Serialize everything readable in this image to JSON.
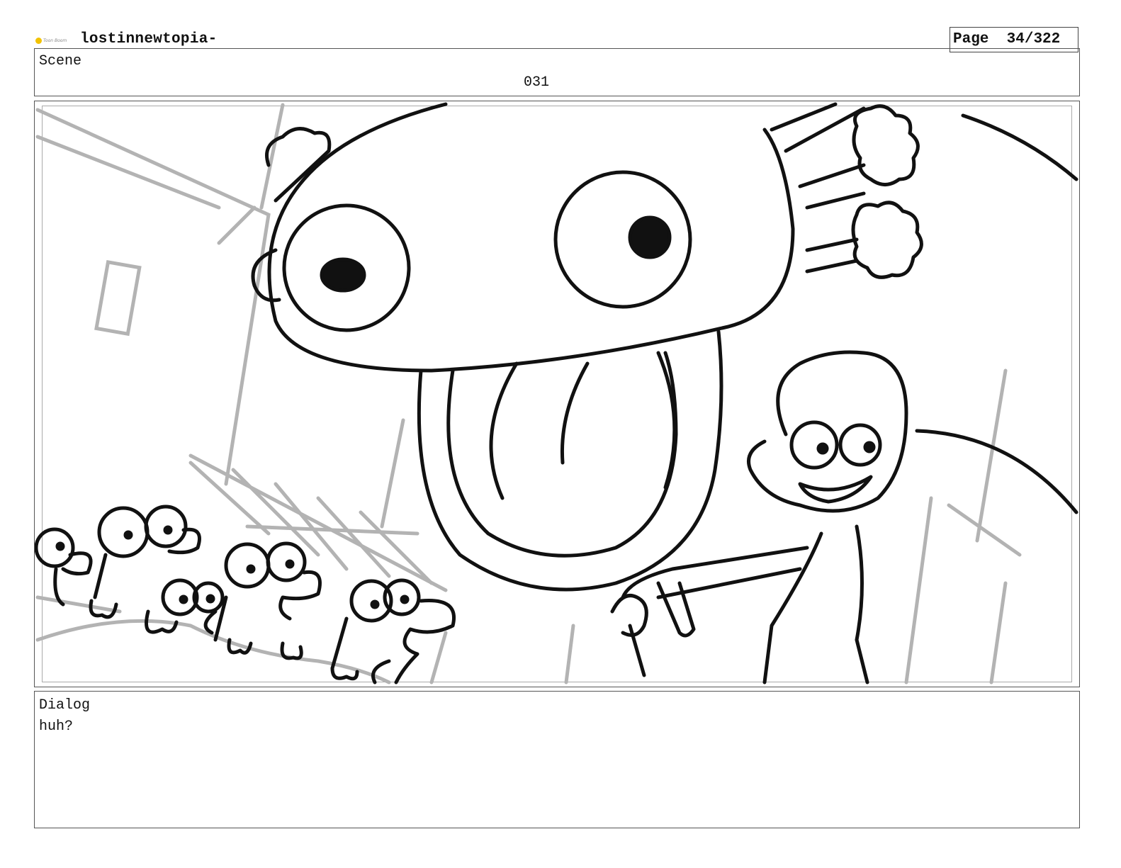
{
  "header": {
    "logo_text": "Toon Boom",
    "project_title": "lostinnewtopia-",
    "page_label": "Page",
    "page_number": "34/322"
  },
  "scene": {
    "label": "Scene",
    "number": "031"
  },
  "panel": {
    "description_icon": "storyboard-sketch"
  },
  "dialog": {
    "label": "Dialog",
    "text": "huh?"
  }
}
